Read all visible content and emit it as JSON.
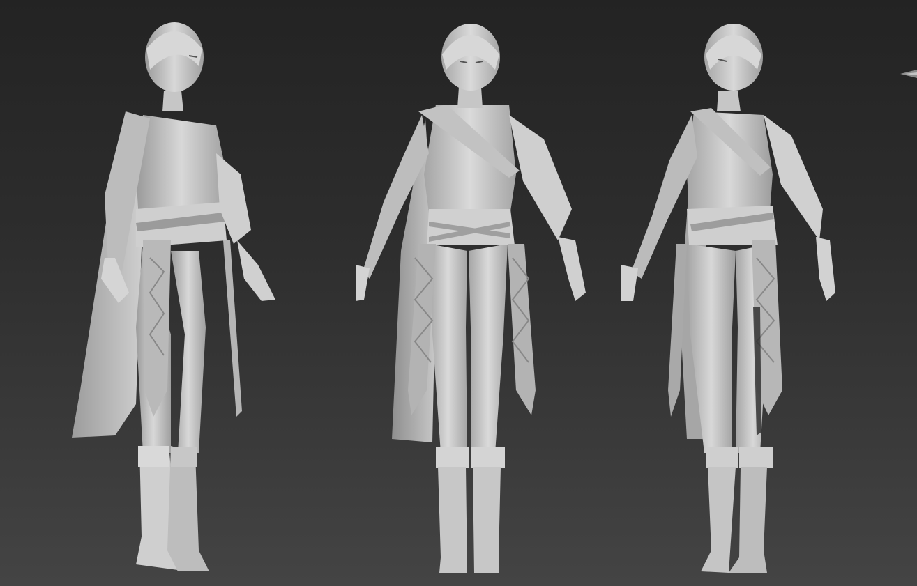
{
  "viewport": {
    "corner_label": "",
    "name": "perspective-viewport"
  },
  "models": [
    {
      "view": "three-quarter-left"
    },
    {
      "view": "front"
    },
    {
      "view": "three-quarter-right"
    }
  ],
  "colors": {
    "background_top": "#232323",
    "background_bottom": "#444444",
    "model_light": "#d6d6d6",
    "model_mid": "#a9a9a9",
    "model_shadow": "#7a7a7a"
  }
}
